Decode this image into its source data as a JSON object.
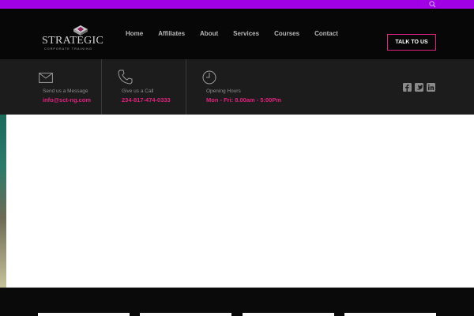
{
  "brand": {
    "name": "STRATEGIC",
    "tagline": "CORPORATE TRAINING"
  },
  "nav": {
    "items": [
      "Home",
      "Affiliates",
      "About",
      "Services",
      "Courses",
      "Contact"
    ]
  },
  "cta": {
    "label": "TALK TO US"
  },
  "info": {
    "message": {
      "label": "Send us a Message",
      "value": "info@sct-ng.com"
    },
    "call": {
      "label": "Give us a Call",
      "value": "234-817-474-0333"
    },
    "hours": {
      "label": "Opening Hours",
      "value": "Mon - Fri: 8.00am - 5:00Pm"
    }
  },
  "colors": {
    "accent": "#e0217f",
    "topbar": "#a100e6",
    "header_bg": "#070707",
    "infobar_bg": "#1c1c1c"
  },
  "icons": {
    "topbar": "search-icon",
    "info": [
      "envelope-icon",
      "phone-icon",
      "clock-icon"
    ],
    "social": [
      "facebook-icon",
      "twitter-icon",
      "linkedin-icon"
    ]
  }
}
